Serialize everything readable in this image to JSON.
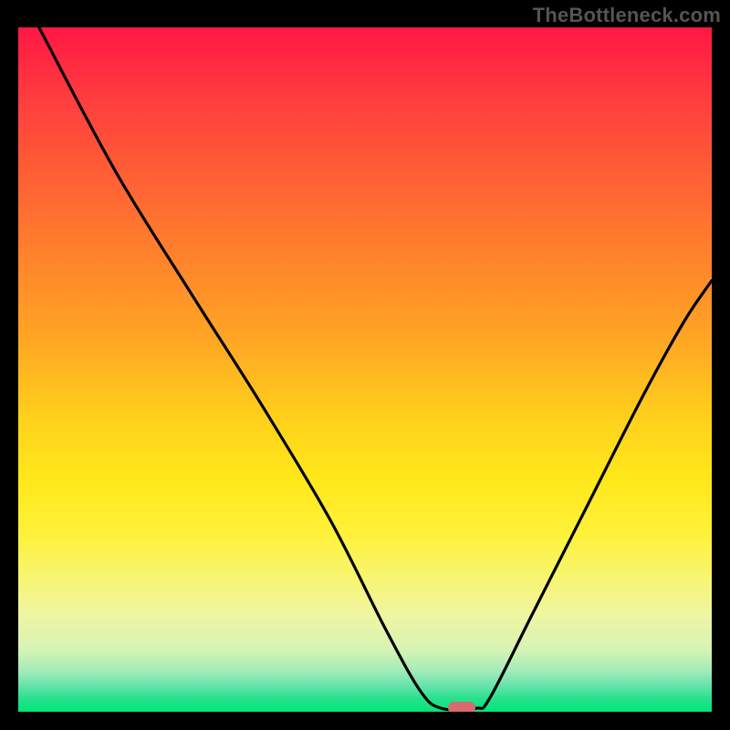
{
  "watermark": "TheBottleneck.com",
  "chart_data": {
    "type": "line",
    "title": "",
    "xlabel": "",
    "ylabel": "",
    "xlim": [
      0,
      100
    ],
    "ylim": [
      0,
      100
    ],
    "series": [
      {
        "name": "curve",
        "color": "#000000",
        "points": [
          {
            "x": 3,
            "y": 100
          },
          {
            "x": 14,
            "y": 79
          },
          {
            "x": 25,
            "y": 61
          },
          {
            "x": 35,
            "y": 45
          },
          {
            "x": 45,
            "y": 28
          },
          {
            "x": 53,
            "y": 12
          },
          {
            "x": 58,
            "y": 3
          },
          {
            "x": 61,
            "y": 0.5
          },
          {
            "x": 66,
            "y": 0.5
          },
          {
            "x": 68,
            "y": 2
          },
          {
            "x": 74,
            "y": 14
          },
          {
            "x": 82,
            "y": 30
          },
          {
            "x": 90,
            "y": 46
          },
          {
            "x": 96,
            "y": 57
          },
          {
            "x": 100,
            "y": 63
          }
        ]
      }
    ],
    "marker": {
      "x": 64,
      "y": 0.5,
      "color": "#d96a6f"
    },
    "gradient_stops": [
      {
        "pos": 0,
        "color": "#ff1744"
      },
      {
        "pos": 66,
        "color": "#ffe81a"
      },
      {
        "pos": 100,
        "color": "#00e676"
      }
    ]
  }
}
